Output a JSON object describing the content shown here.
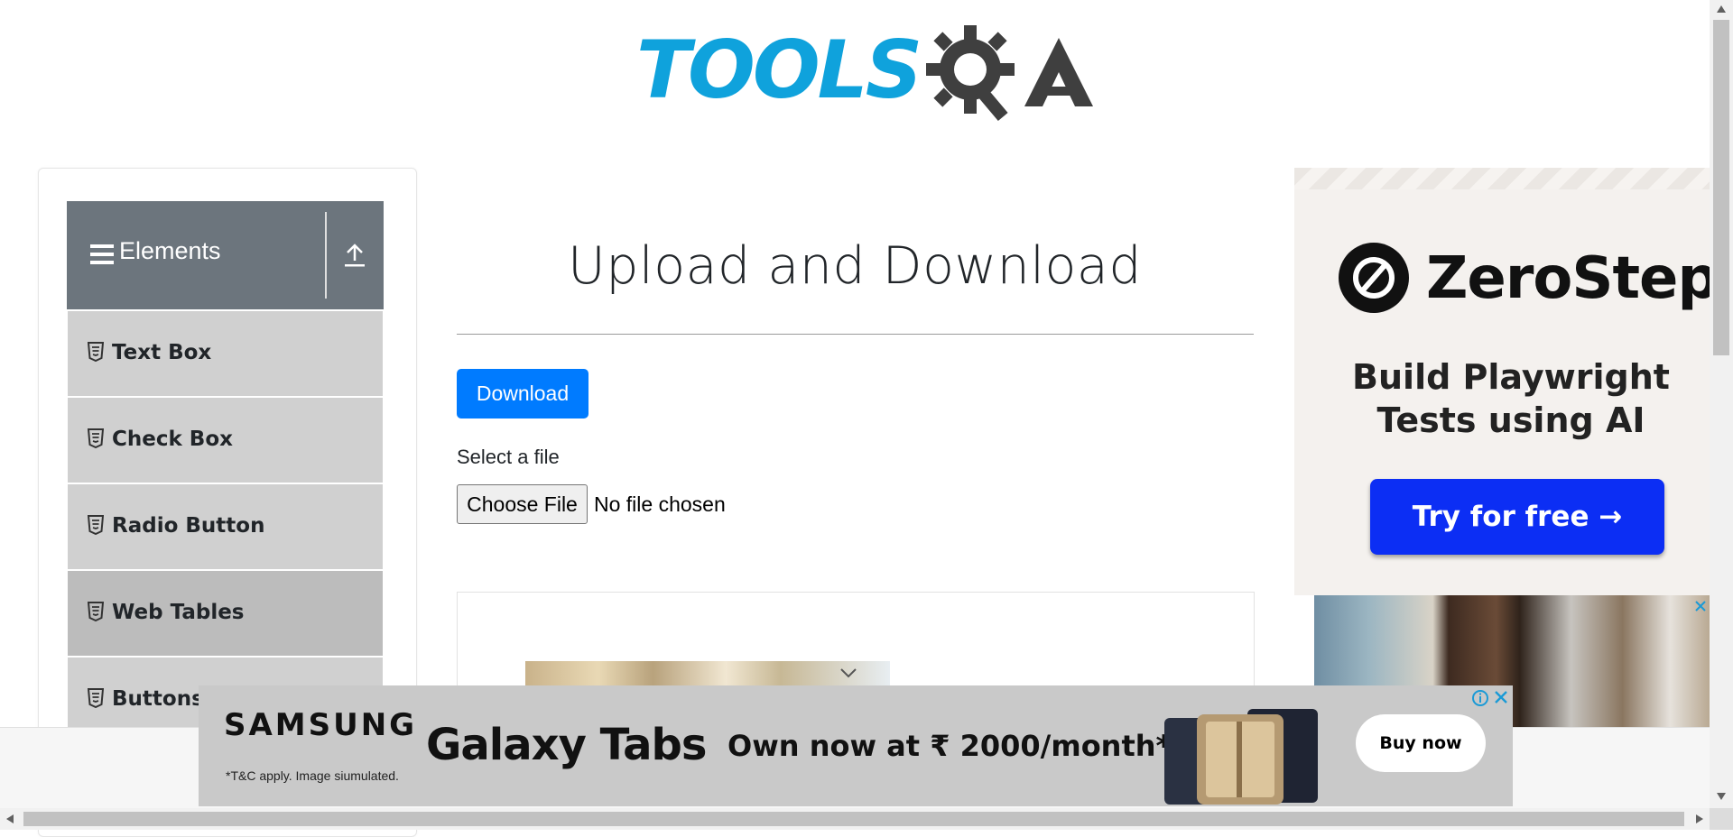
{
  "header": {
    "logo_text": "TOOLS",
    "logo_suffix": "QA"
  },
  "sidebar": {
    "group_title": "Elements",
    "items": [
      {
        "label": "Text Box",
        "active": false
      },
      {
        "label": "Check Box",
        "active": false
      },
      {
        "label": "Radio Button",
        "active": false
      },
      {
        "label": "Web Tables",
        "active": true
      },
      {
        "label": "Buttons",
        "active": false
      }
    ]
  },
  "main": {
    "title": "Upload and Download",
    "download_label": "Download",
    "select_label": "Select a file",
    "choose_file_label": "Choose File",
    "no_file_text": "No file chosen"
  },
  "right_ad": {
    "brand": "ZeroStep",
    "tagline": "Build Playwright Tests using AI",
    "cta": "Try for free →"
  },
  "bottom_ad": {
    "brand": "SAMSUNG",
    "disclaimer": "*T&C apply. Image siumulated.",
    "product": "Galaxy Tabs",
    "offer": "Own now at ₹ 2000/month*",
    "cta": "Buy now"
  },
  "colors": {
    "accent": "#007bff",
    "logo_blue": "#0fa2dc",
    "sidebar_header": "#6c757d",
    "menu_item_bg": "#d0d0d0",
    "menu_item_active": "#bcbcbc",
    "zerostep_button": "#0c2ef4"
  }
}
